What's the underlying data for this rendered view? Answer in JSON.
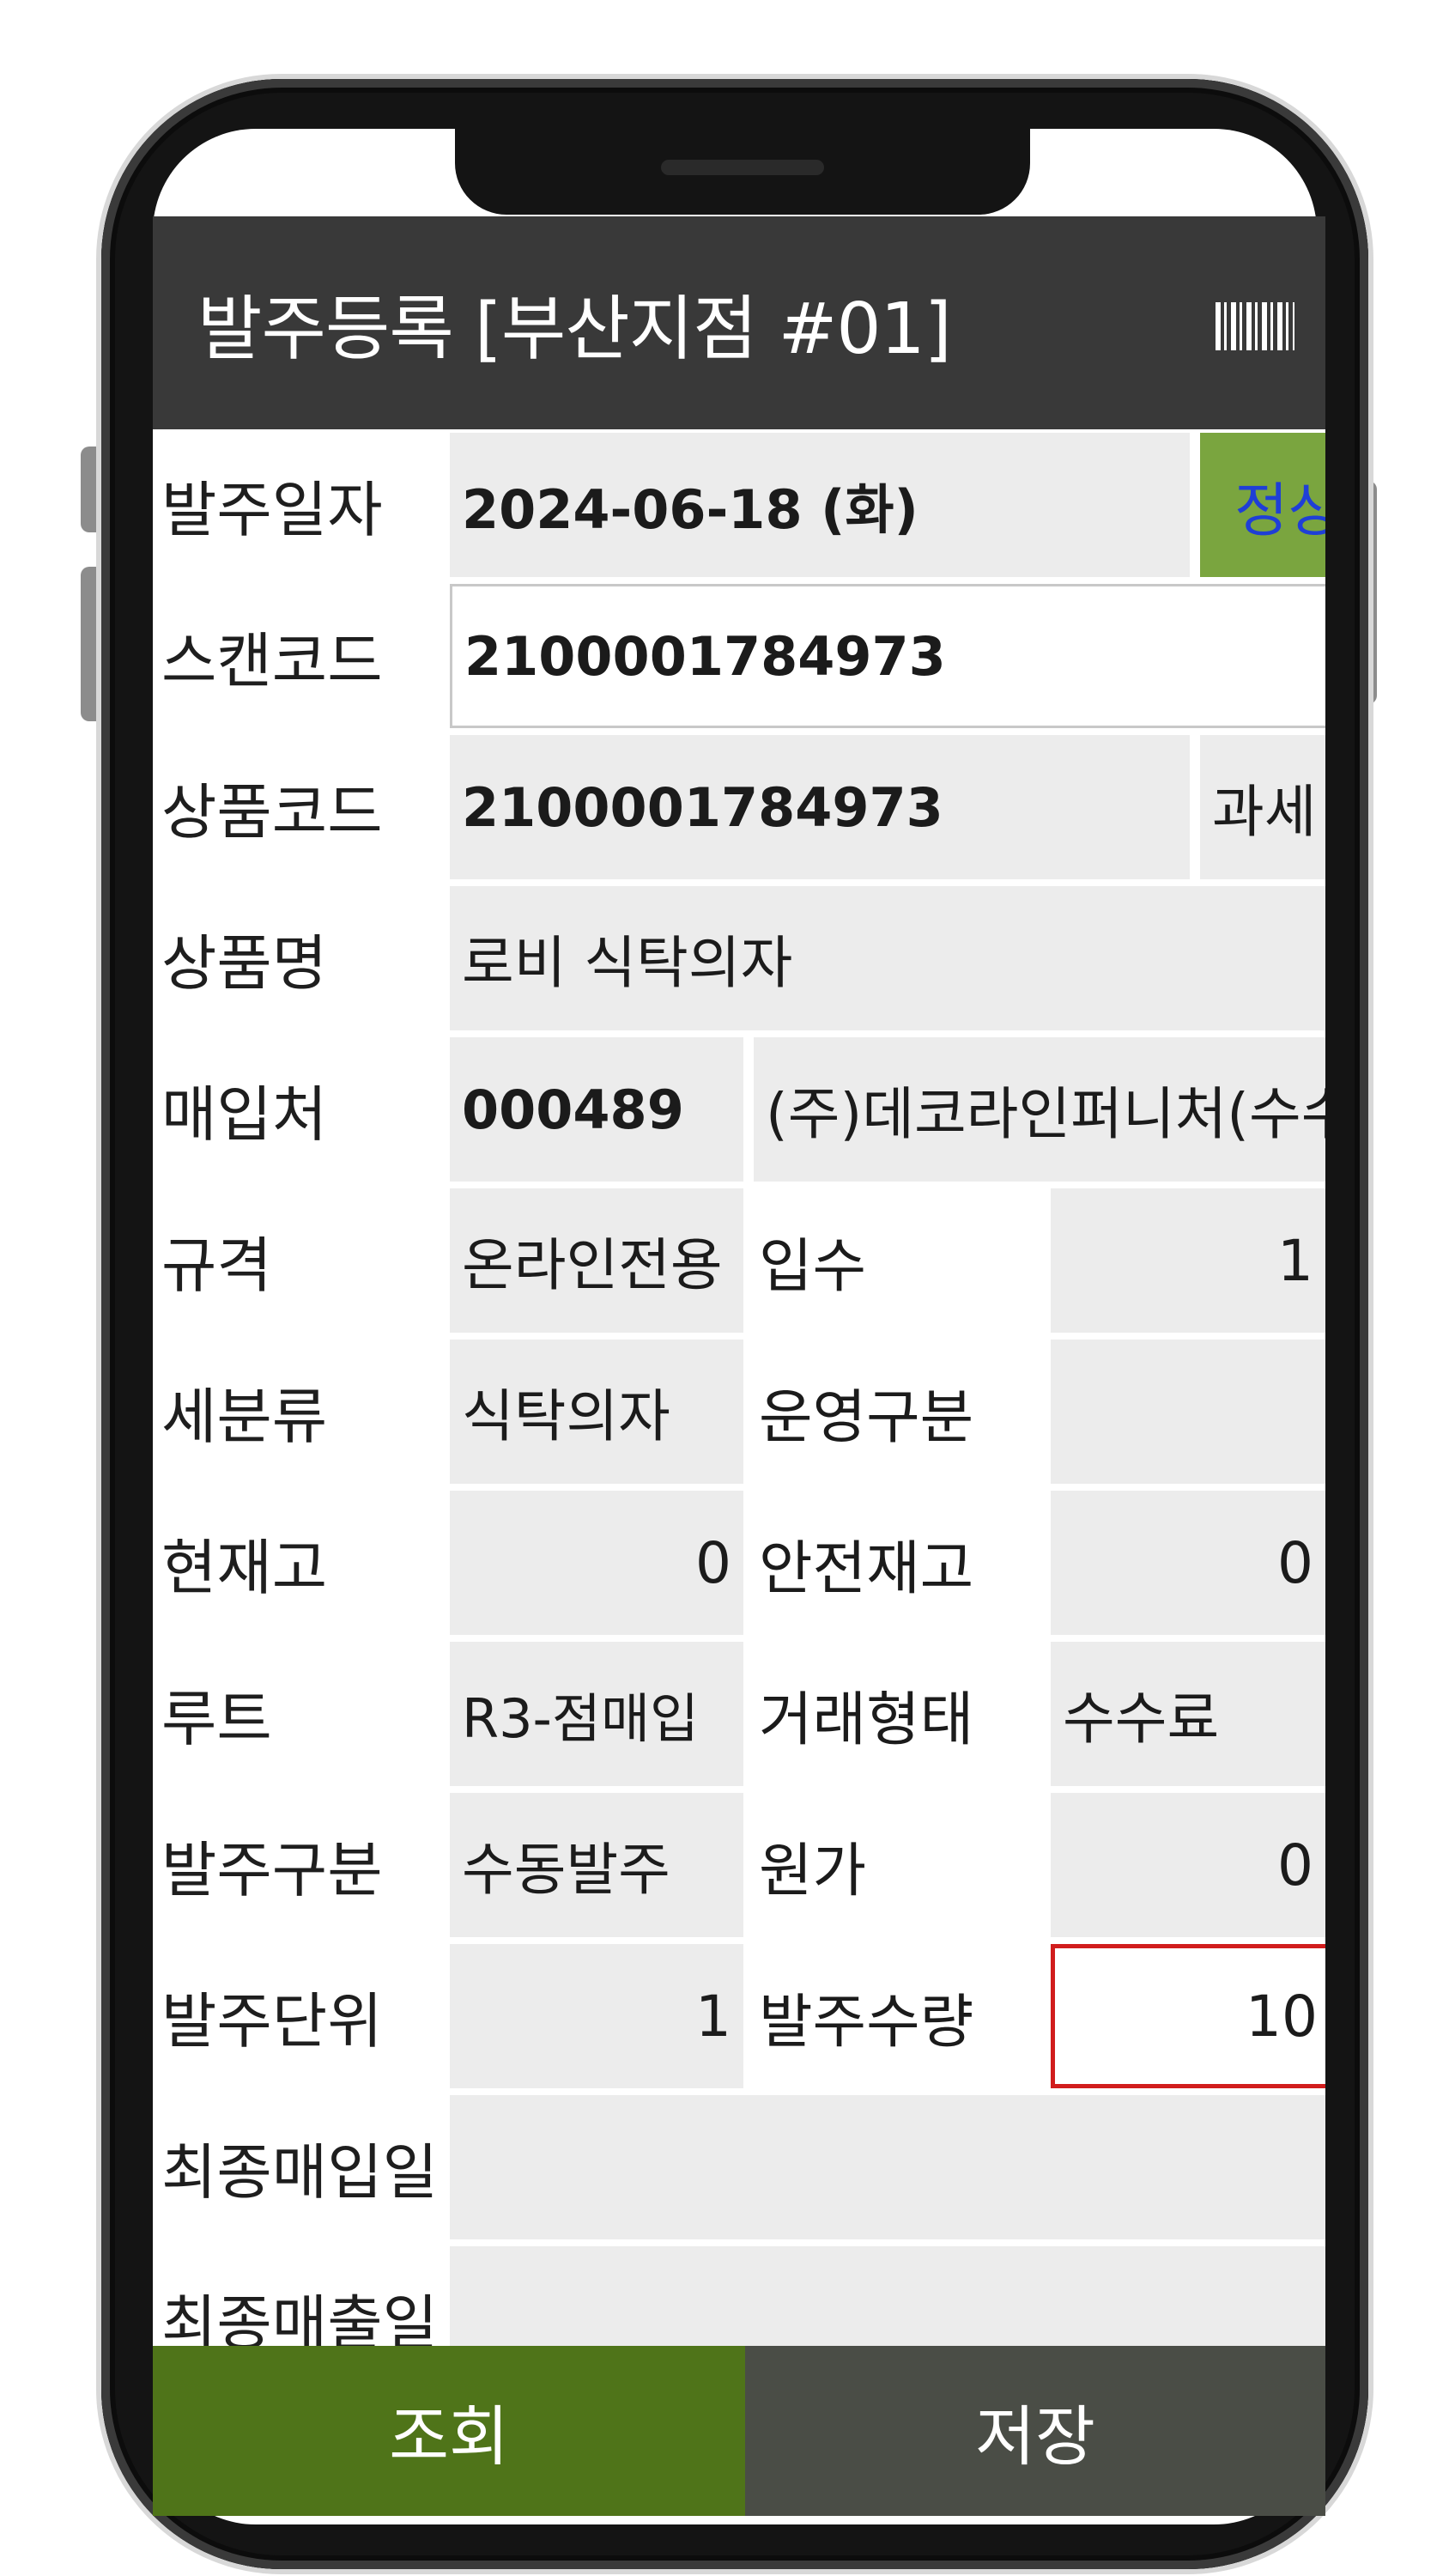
{
  "header": {
    "title": "발주등록 [부산지점 #01]",
    "icon": "barcode-icon"
  },
  "form": {
    "order_date": {
      "label": "발주일자",
      "value": "2024-06-18 (화)",
      "type": "정상발주"
    },
    "scan_code": {
      "label": "스캔코드",
      "value": "2100001784973"
    },
    "product_code": {
      "label": "상품코드",
      "value": "2100001784973",
      "tax": "과세"
    },
    "product_name": {
      "label": "상품명",
      "value": "로비 식탁의자"
    },
    "supplier": {
      "label": "매입처",
      "code": "000489",
      "name": "(주)데코라인퍼니처(수수"
    },
    "spec": {
      "label": "규격",
      "value": "온라인전용",
      "units_label": "입수",
      "units": "1"
    },
    "subcategory": {
      "label": "세분류",
      "value": "식탁의자",
      "op_label": "운영구분",
      "op_value": ""
    },
    "stock": {
      "label": "현재고",
      "value": "0",
      "safety_label": "안전재고",
      "safety": "0"
    },
    "route": {
      "label": "루트",
      "value": "R3-점매입",
      "trade_label": "거래형태",
      "trade": "수수료"
    },
    "order_type": {
      "label": "발주구분",
      "value": "수동발주",
      "cost_label": "원가",
      "cost": "0"
    },
    "order_unit": {
      "label": "발주단위",
      "value": "1",
      "qty_label": "발주수량",
      "qty": "10"
    },
    "last_purchase": {
      "label": "최종매입일",
      "value": ""
    },
    "last_sale": {
      "label": "최종매출일",
      "value": ""
    }
  },
  "buttons": {
    "search": "조회",
    "save": "저장"
  },
  "colors": {
    "appbar": "#393939",
    "accent_green": "#4f7419",
    "order_type_bg": "#7aa53f",
    "order_type_text": "#1f3fd6",
    "qty_border": "#d11d1d"
  }
}
